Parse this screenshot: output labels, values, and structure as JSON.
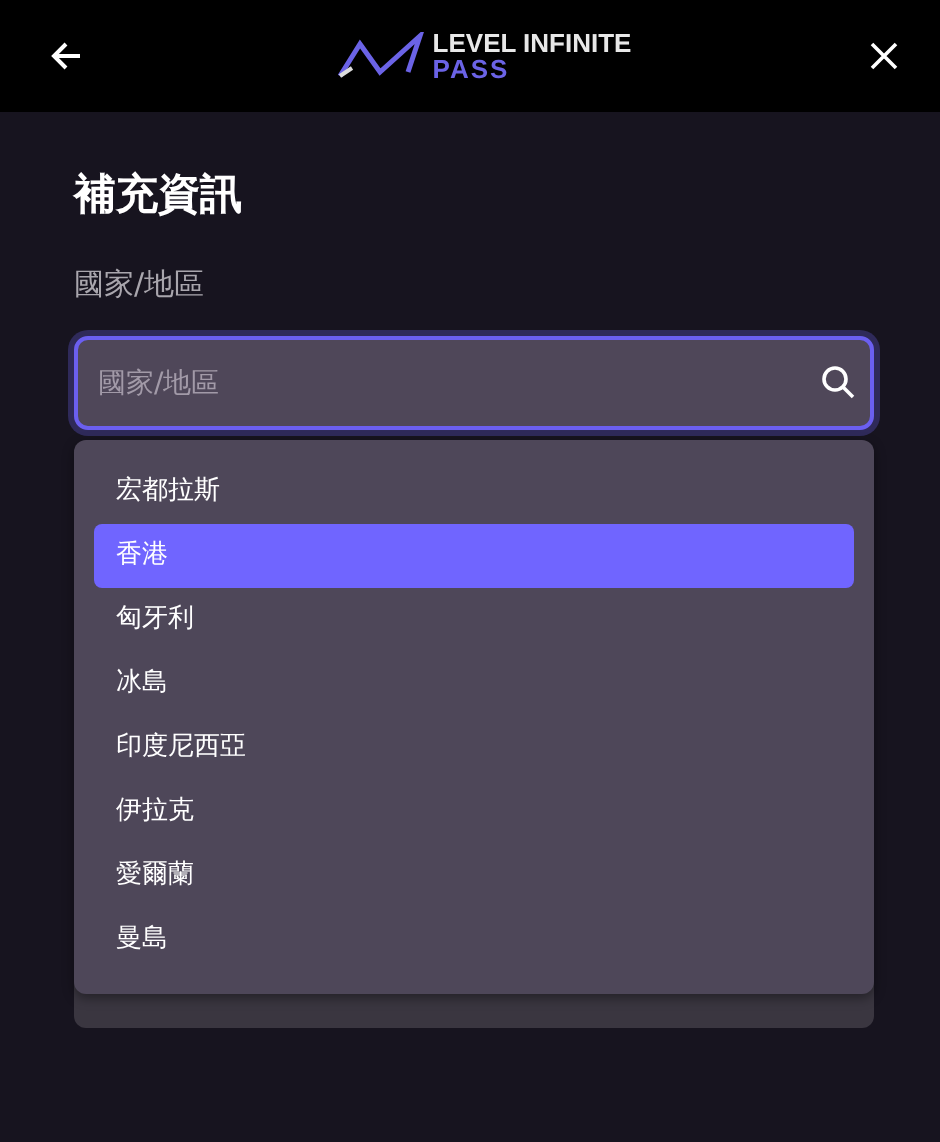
{
  "header": {
    "logo_line_1": "LEVEL INFINITE",
    "logo_line_2": "PASS"
  },
  "title": "補充資訊",
  "country_field": {
    "label": "國家/地區",
    "placeholder": "國家/地區"
  },
  "dropdown": {
    "options": [
      {
        "label": "宏都拉斯",
        "selected": false
      },
      {
        "label": "香港",
        "selected": true
      },
      {
        "label": "匈牙利",
        "selected": false
      },
      {
        "label": "冰島",
        "selected": false
      },
      {
        "label": "印度尼西亞",
        "selected": false
      },
      {
        "label": "伊拉克",
        "selected": false
      },
      {
        "label": "愛爾蘭",
        "selected": false
      },
      {
        "label": "曼島",
        "selected": false
      }
    ]
  },
  "submit_button": {
    "disabled": true
  }
}
